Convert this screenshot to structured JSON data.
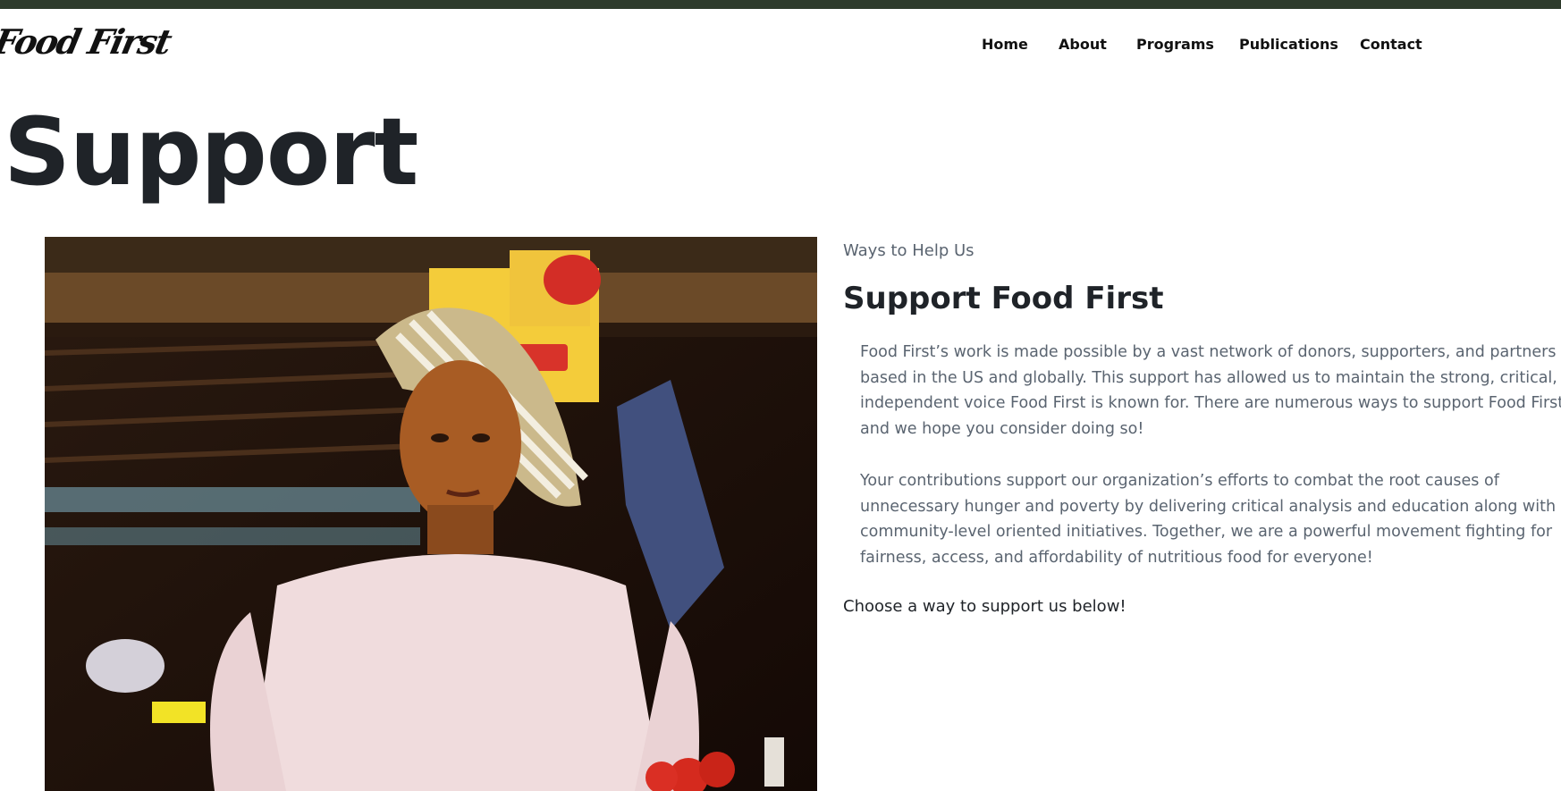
{
  "header": {
    "logo_text": "Food First",
    "nav": [
      {
        "label": "Home"
      },
      {
        "label": "About"
      },
      {
        "label": "Programs"
      },
      {
        "label": "Publications"
      },
      {
        "label": "Contact"
      }
    ]
  },
  "page": {
    "title": "Support"
  },
  "photo": {
    "alt": "Woman with a striped head wrap at a market stall"
  },
  "content": {
    "eyebrow": "Ways to Help Us",
    "heading": "Support Food First",
    "paragraph1": "Food First’s work is made possible by a vast network of donors, supporters, and partners based in the US and globally. This support has allowed us to maintain the strong, critical, and independent voice Food First is known for. There are numerous ways to support Food First and we hope you consider doing so!",
    "paragraph2": "Your contributions support our organization’s efforts to combat the root causes of unnecessary hunger and poverty by delivering critical analysis and education along with community-level oriented initiatives. Together, we are a powerful movement fighting for fairness, access, and affordability of nutritious food for everyone!",
    "cta": "Choose a way to support us below!"
  },
  "colors": {
    "topbar": "#2e3b2c",
    "text": "#1f2328",
    "muted": "#5a6470"
  }
}
